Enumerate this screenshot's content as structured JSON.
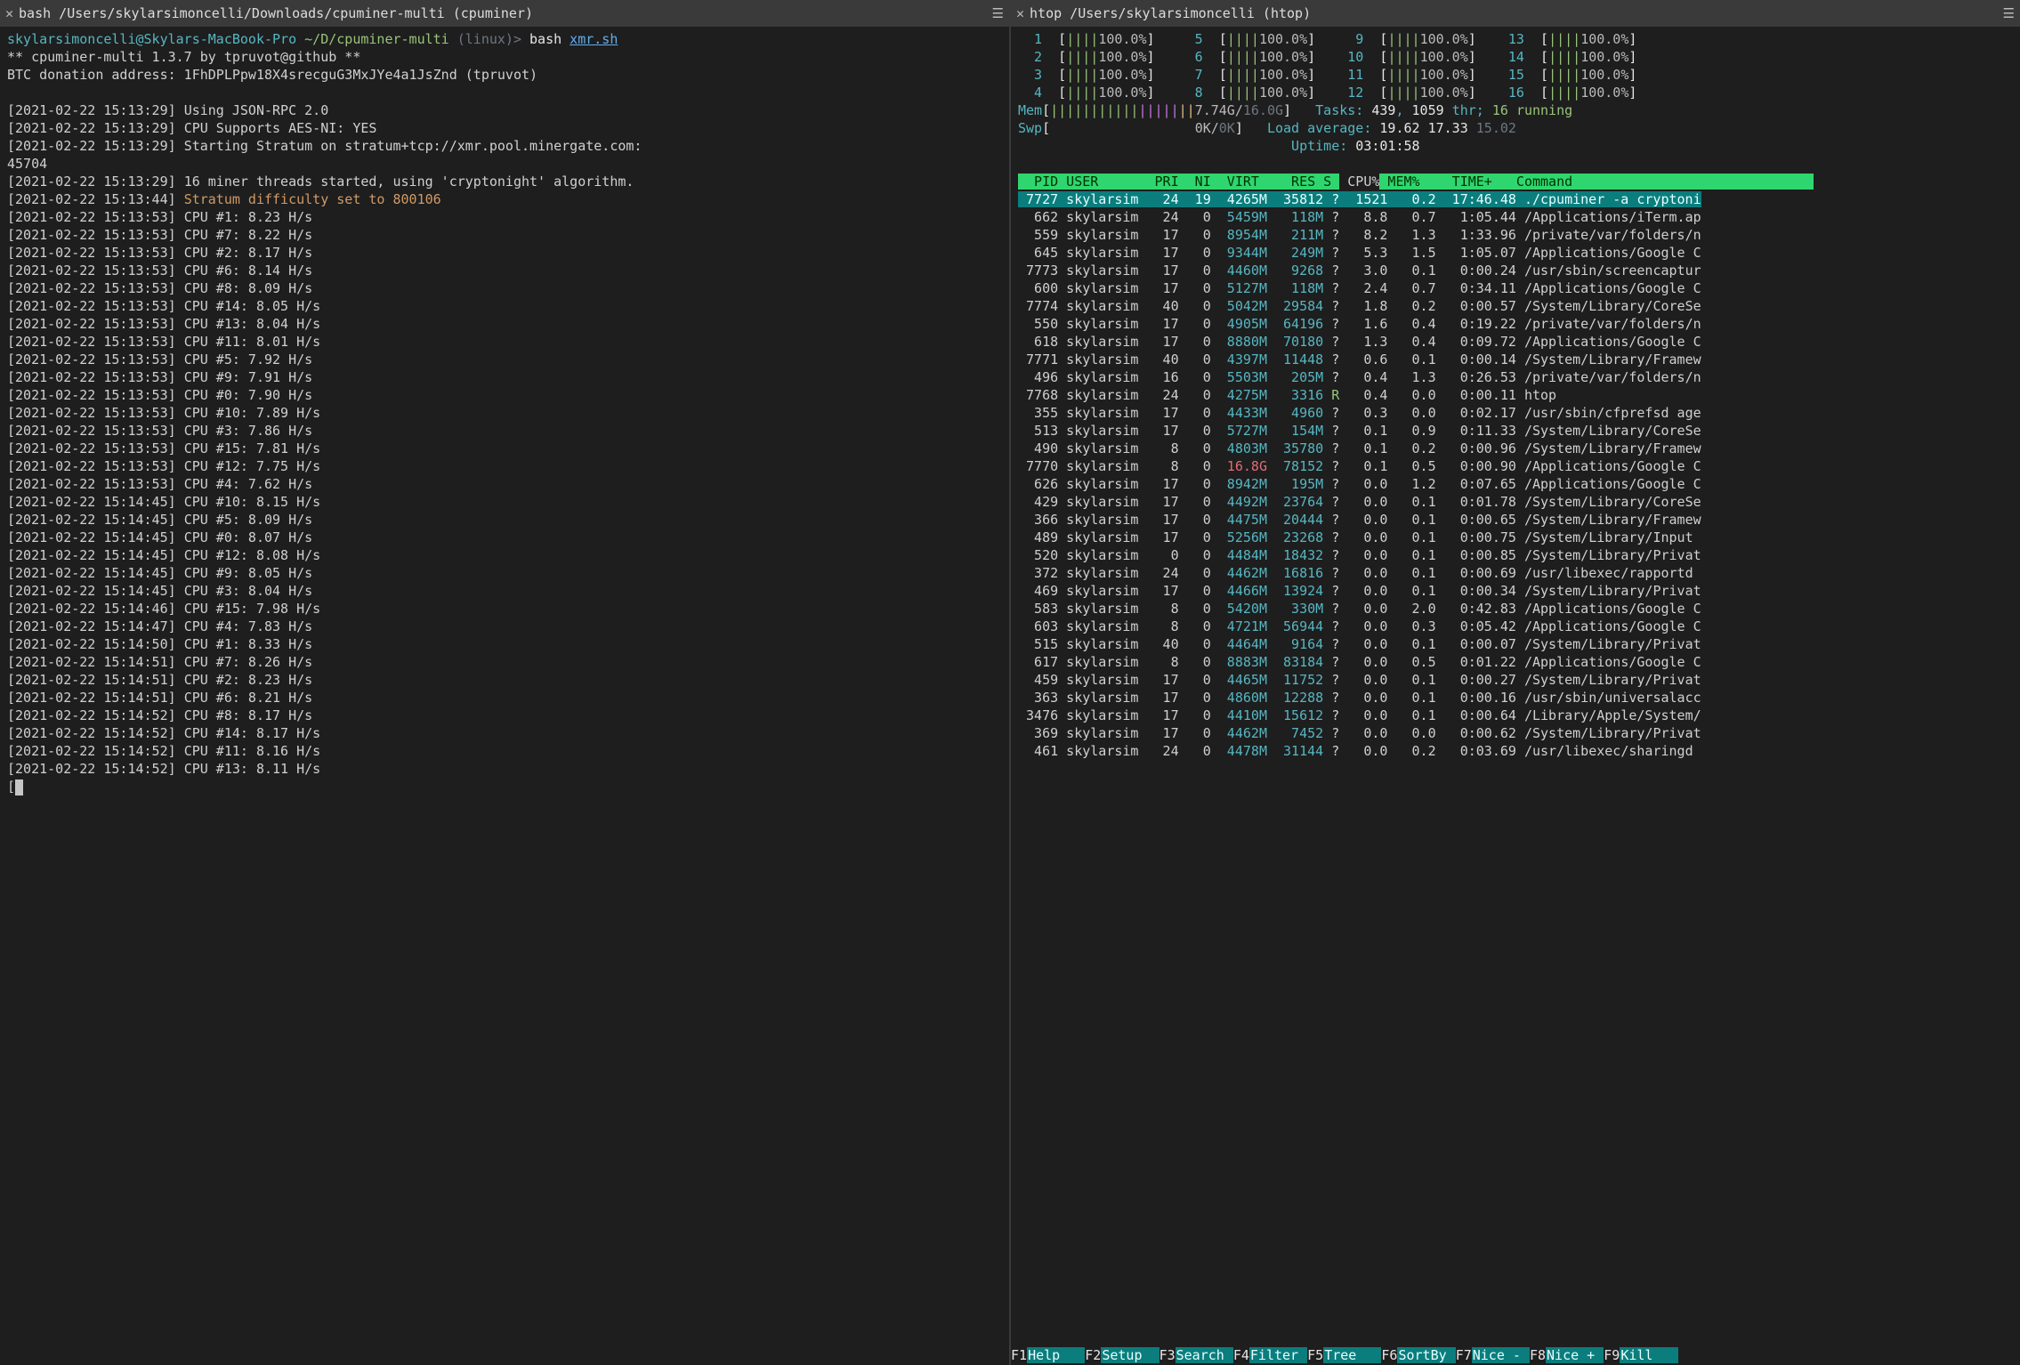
{
  "left": {
    "tab_title": "bash /Users/skylarsimoncelli/Downloads/cpuminer-multi (cpuminer)",
    "prompt": {
      "userhost": "skylarsimoncelli@Skylars-MacBook-Pro",
      "path": "~/D/cpuminer-multi",
      "env": "(linux)",
      "sep": ">",
      "cmd": "bash",
      "arg": "xmr.sh"
    },
    "plain": [
      "** cpuminer-multi 1.3.7 by tpruvot@github **",
      "BTC donation address: 1FhDPLPpw18X4srecguG3MxJYe4a1JsZnd (tpruvot)",
      ""
    ],
    "loglines": [
      {
        "ts": "[2021-02-22 15:13:29]",
        "msg": "Using JSON-RPC 2.0"
      },
      {
        "ts": "[2021-02-22 15:13:29]",
        "msg": "CPU Supports AES-NI: YES"
      },
      {
        "ts": "[2021-02-22 15:13:29]",
        "msg": "Starting Stratum on stratum+tcp://xmr.pool.minergate.com:"
      },
      {
        "cont": "45704"
      },
      {
        "ts": "[2021-02-22 15:13:29]",
        "msg": "16 miner threads started, using 'cryptonight' algorithm."
      },
      {
        "ts": "[2021-02-22 15:13:44]",
        "msg": "Stratum difficulty set to 800106",
        "yellow": true
      },
      {
        "ts": "[2021-02-22 15:13:53]",
        "msg": "CPU #1: 8.23 H/s"
      },
      {
        "ts": "[2021-02-22 15:13:53]",
        "msg": "CPU #7: 8.22 H/s"
      },
      {
        "ts": "[2021-02-22 15:13:53]",
        "msg": "CPU #2: 8.17 H/s"
      },
      {
        "ts": "[2021-02-22 15:13:53]",
        "msg": "CPU #6: 8.14 H/s"
      },
      {
        "ts": "[2021-02-22 15:13:53]",
        "msg": "CPU #8: 8.09 H/s"
      },
      {
        "ts": "[2021-02-22 15:13:53]",
        "msg": "CPU #14: 8.05 H/s"
      },
      {
        "ts": "[2021-02-22 15:13:53]",
        "msg": "CPU #13: 8.04 H/s"
      },
      {
        "ts": "[2021-02-22 15:13:53]",
        "msg": "CPU #11: 8.01 H/s"
      },
      {
        "ts": "[2021-02-22 15:13:53]",
        "msg": "CPU #5: 7.92 H/s"
      },
      {
        "ts": "[2021-02-22 15:13:53]",
        "msg": "CPU #9: 7.91 H/s"
      },
      {
        "ts": "[2021-02-22 15:13:53]",
        "msg": "CPU #0: 7.90 H/s"
      },
      {
        "ts": "[2021-02-22 15:13:53]",
        "msg": "CPU #10: 7.89 H/s"
      },
      {
        "ts": "[2021-02-22 15:13:53]",
        "msg": "CPU #3: 7.86 H/s"
      },
      {
        "ts": "[2021-02-22 15:13:53]",
        "msg": "CPU #15: 7.81 H/s"
      },
      {
        "ts": "[2021-02-22 15:13:53]",
        "msg": "CPU #12: 7.75 H/s"
      },
      {
        "ts": "[2021-02-22 15:13:53]",
        "msg": "CPU #4: 7.62 H/s"
      },
      {
        "ts": "[2021-02-22 15:14:45]",
        "msg": "CPU #10: 8.15 H/s"
      },
      {
        "ts": "[2021-02-22 15:14:45]",
        "msg": "CPU #5: 8.09 H/s"
      },
      {
        "ts": "[2021-02-22 15:14:45]",
        "msg": "CPU #0: 8.07 H/s"
      },
      {
        "ts": "[2021-02-22 15:14:45]",
        "msg": "CPU #12: 8.08 H/s"
      },
      {
        "ts": "[2021-02-22 15:14:45]",
        "msg": "CPU #9: 8.05 H/s"
      },
      {
        "ts": "[2021-02-22 15:14:45]",
        "msg": "CPU #3: 8.04 H/s"
      },
      {
        "ts": "[2021-02-22 15:14:46]",
        "msg": "CPU #15: 7.98 H/s"
      },
      {
        "ts": "[2021-02-22 15:14:47]",
        "msg": "CPU #4: 7.83 H/s"
      },
      {
        "ts": "[2021-02-22 15:14:50]",
        "msg": "CPU #1: 8.33 H/s"
      },
      {
        "ts": "[2021-02-22 15:14:51]",
        "msg": "CPU #7: 8.26 H/s"
      },
      {
        "ts": "[2021-02-22 15:14:51]",
        "msg": "CPU #2: 8.23 H/s"
      },
      {
        "ts": "[2021-02-22 15:14:51]",
        "msg": "CPU #6: 8.21 H/s"
      },
      {
        "ts": "[2021-02-22 15:14:52]",
        "msg": "CPU #8: 8.17 H/s"
      },
      {
        "ts": "[2021-02-22 15:14:52]",
        "msg": "CPU #14: 8.17 H/s"
      },
      {
        "ts": "[2021-02-22 15:14:52]",
        "msg": "CPU #11: 8.16 H/s"
      },
      {
        "ts": "[2021-02-22 15:14:52]",
        "msg": "CPU #13: 8.11 H/s"
      }
    ]
  },
  "right": {
    "tab_title": "htop /Users/skylarsimoncelli (htop)",
    "cpus": [
      {
        "n": "1",
        "pct": "100.0%"
      },
      {
        "n": "5",
        "pct": "100.0%"
      },
      {
        "n": "9",
        "pct": "100.0%"
      },
      {
        "n": "13",
        "pct": "100.0%"
      },
      {
        "n": "2",
        "pct": "100.0%"
      },
      {
        "n": "6",
        "pct": "100.0%"
      },
      {
        "n": "10",
        "pct": "100.0%"
      },
      {
        "n": "14",
        "pct": "100.0%"
      },
      {
        "n": "3",
        "pct": "100.0%"
      },
      {
        "n": "7",
        "pct": "100.0%"
      },
      {
        "n": "11",
        "pct": "100.0%"
      },
      {
        "n": "15",
        "pct": "100.0%"
      },
      {
        "n": "4",
        "pct": "100.0%"
      },
      {
        "n": "8",
        "pct": "100.0%"
      },
      {
        "n": "12",
        "pct": "100.0%"
      },
      {
        "n": "16",
        "pct": "100.0%"
      }
    ],
    "mem": {
      "label": "Mem",
      "used": "7.74G",
      "total": "16.0G"
    },
    "swp": {
      "label": "Swp",
      "used": "0K",
      "total": "0K"
    },
    "tasks": {
      "label": "Tasks:",
      "procs": "439",
      "thr_label": "1059",
      "thr_word": "thr;",
      "running": "16",
      "run_word": "running"
    },
    "load": {
      "label": "Load average:",
      "v1": "19.62",
      "v2": "17.33",
      "v3": "15.02"
    },
    "uptime": {
      "label": "Uptime:",
      "val": "03:01:58"
    },
    "header": [
      "  PID",
      "USER     ",
      " PRI",
      " NI",
      " VIRT",
      "  RES",
      "S",
      " CPU%",
      "MEM%",
      "   TIME+ ",
      " Command"
    ],
    "procs": [
      {
        "sel": true,
        "pid": "7727",
        "user": "skylarsim",
        "pri": "24",
        "ni": "19",
        "virt": "4265M",
        "res": "35812",
        "s": "?",
        "cpu": "1521",
        "mem": "0.2",
        "time": "17:46.48",
        "cmd": "./cpuminer -a cryptoni"
      },
      {
        "pid": "662",
        "user": "skylarsim",
        "pri": "24",
        "ni": "0",
        "virt": "5459M",
        "res": "118M",
        "s": "?",
        "cpu": "8.8",
        "mem": "0.7",
        "time": "1:05.44",
        "cmd": "/Applications/iTerm.ap"
      },
      {
        "pid": "559",
        "user": "skylarsim",
        "pri": "17",
        "ni": "0",
        "virt": "8954M",
        "res": "211M",
        "s": "?",
        "cpu": "8.2",
        "mem": "1.3",
        "time": "1:33.96",
        "cmd": "/private/var/folders/n"
      },
      {
        "pid": "645",
        "user": "skylarsim",
        "pri": "17",
        "ni": "0",
        "virt": "9344M",
        "res": "249M",
        "s": "?",
        "cpu": "5.3",
        "mem": "1.5",
        "time": "1:05.07",
        "cmd": "/Applications/Google C"
      },
      {
        "pid": "7773",
        "user": "skylarsim",
        "pri": "17",
        "ni": "0",
        "virt": "4460M",
        "res": "9268",
        "s": "?",
        "cpu": "3.0",
        "mem": "0.1",
        "time": "0:00.24",
        "cmd": "/usr/sbin/screencaptur"
      },
      {
        "pid": "600",
        "user": "skylarsim",
        "pri": "17",
        "ni": "0",
        "virt": "5127M",
        "res": "118M",
        "s": "?",
        "cpu": "2.4",
        "mem": "0.7",
        "time": "0:34.11",
        "cmd": "/Applications/Google C"
      },
      {
        "pid": "7774",
        "user": "skylarsim",
        "pri": "40",
        "ni": "0",
        "virt": "5042M",
        "res": "29584",
        "s": "?",
        "cpu": "1.8",
        "mem": "0.2",
        "time": "0:00.57",
        "cmd": "/System/Library/CoreSe"
      },
      {
        "pid": "550",
        "user": "skylarsim",
        "pri": "17",
        "ni": "0",
        "virt": "4905M",
        "res": "64196",
        "s": "?",
        "cpu": "1.6",
        "mem": "0.4",
        "time": "0:19.22",
        "cmd": "/private/var/folders/n"
      },
      {
        "pid": "618",
        "user": "skylarsim",
        "pri": "17",
        "ni": "0",
        "virt": "8880M",
        "res": "70180",
        "s": "?",
        "cpu": "1.3",
        "mem": "0.4",
        "time": "0:09.72",
        "cmd": "/Applications/Google C"
      },
      {
        "pid": "7771",
        "user": "skylarsim",
        "pri": "40",
        "ni": "0",
        "virt": "4397M",
        "res": "11448",
        "s": "?",
        "cpu": "0.6",
        "mem": "0.1",
        "time": "0:00.14",
        "cmd": "/System/Library/Framew"
      },
      {
        "pid": "496",
        "user": "skylarsim",
        "pri": "16",
        "ni": "0",
        "virt": "5503M",
        "res": "205M",
        "s": "?",
        "cpu": "0.4",
        "mem": "1.3",
        "time": "0:26.53",
        "cmd": "/private/var/folders/n"
      },
      {
        "pid": "7768",
        "user": "skylarsim",
        "pri": "24",
        "ni": "0",
        "virt": "4275M",
        "res": "3316",
        "s": "R",
        "cpu": "0.4",
        "mem": "0.0",
        "time": "0:00.11",
        "cmd": "htop",
        "green": true
      },
      {
        "pid": "355",
        "user": "skylarsim",
        "pri": "17",
        "ni": "0",
        "virt": "4433M",
        "res": "4960",
        "s": "?",
        "cpu": "0.3",
        "mem": "0.0",
        "time": "0:02.17",
        "cmd": "/usr/sbin/cfprefsd age"
      },
      {
        "pid": "513",
        "user": "skylarsim",
        "pri": "17",
        "ni": "0",
        "virt": "5727M",
        "res": "154M",
        "s": "?",
        "cpu": "0.1",
        "mem": "0.9",
        "time": "0:11.33",
        "cmd": "/System/Library/CoreSe"
      },
      {
        "pid": "490",
        "user": "skylarsim",
        "pri": "8",
        "ni": "0",
        "virt": "4803M",
        "res": "35780",
        "s": "?",
        "cpu": "0.1",
        "mem": "0.2",
        "time": "0:00.96",
        "cmd": "/System/Library/Framew"
      },
      {
        "pid": "7770",
        "user": "skylarsim",
        "pri": "8",
        "ni": "0",
        "virt": "16.8G",
        "virt_red": true,
        "res": "78152",
        "s": "?",
        "cpu": "0.1",
        "mem": "0.5",
        "time": "0:00.90",
        "cmd": "/Applications/Google C"
      },
      {
        "pid": "626",
        "user": "skylarsim",
        "pri": "17",
        "ni": "0",
        "virt": "8942M",
        "res": "195M",
        "s": "?",
        "cpu": "0.0",
        "mem": "1.2",
        "time": "0:07.65",
        "cmd": "/Applications/Google C"
      },
      {
        "pid": "429",
        "user": "skylarsim",
        "pri": "17",
        "ni": "0",
        "virt": "4492M",
        "res": "23764",
        "s": "?",
        "cpu": "0.0",
        "mem": "0.1",
        "time": "0:01.78",
        "cmd": "/System/Library/CoreSe"
      },
      {
        "pid": "366",
        "user": "skylarsim",
        "pri": "17",
        "ni": "0",
        "virt": "4475M",
        "res": "20444",
        "s": "?",
        "cpu": "0.0",
        "mem": "0.1",
        "time": "0:00.65",
        "cmd": "/System/Library/Framew"
      },
      {
        "pid": "489",
        "user": "skylarsim",
        "pri": "17",
        "ni": "0",
        "virt": "5256M",
        "res": "23268",
        "s": "?",
        "cpu": "0.0",
        "mem": "0.1",
        "time": "0:00.75",
        "cmd": "/System/Library/Input"
      },
      {
        "pid": "520",
        "user": "skylarsim",
        "pri": "0",
        "ni": "0",
        "virt": "4484M",
        "res": "18432",
        "s": "?",
        "cpu": "0.0",
        "mem": "0.1",
        "time": "0:00.85",
        "cmd": "/System/Library/Privat"
      },
      {
        "pid": "372",
        "user": "skylarsim",
        "pri": "24",
        "ni": "0",
        "virt": "4462M",
        "res": "16816",
        "s": "?",
        "cpu": "0.0",
        "mem": "0.1",
        "time": "0:00.69",
        "cmd": "/usr/libexec/rapportd"
      },
      {
        "pid": "469",
        "user": "skylarsim",
        "pri": "17",
        "ni": "0",
        "virt": "4466M",
        "res": "13924",
        "s": "?",
        "cpu": "0.0",
        "mem": "0.1",
        "time": "0:00.34",
        "cmd": "/System/Library/Privat"
      },
      {
        "pid": "583",
        "user": "skylarsim",
        "pri": "8",
        "ni": "0",
        "virt": "5420M",
        "res": "330M",
        "s": "?",
        "cpu": "0.0",
        "mem": "2.0",
        "time": "0:42.83",
        "cmd": "/Applications/Google C"
      },
      {
        "pid": "603",
        "user": "skylarsim",
        "pri": "8",
        "ni": "0",
        "virt": "4721M",
        "res": "56944",
        "s": "?",
        "cpu": "0.0",
        "mem": "0.3",
        "time": "0:05.42",
        "cmd": "/Applications/Google C"
      },
      {
        "pid": "515",
        "user": "skylarsim",
        "pri": "40",
        "ni": "0",
        "virt": "4464M",
        "res": "9164",
        "s": "?",
        "cpu": "0.0",
        "mem": "0.1",
        "time": "0:00.07",
        "cmd": "/System/Library/Privat"
      },
      {
        "pid": "617",
        "user": "skylarsim",
        "pri": "8",
        "ni": "0",
        "virt": "8883M",
        "res": "83184",
        "s": "?",
        "cpu": "0.0",
        "mem": "0.5",
        "time": "0:01.22",
        "cmd": "/Applications/Google C"
      },
      {
        "pid": "459",
        "user": "skylarsim",
        "pri": "17",
        "ni": "0",
        "virt": "4465M",
        "res": "11752",
        "s": "?",
        "cpu": "0.0",
        "mem": "0.1",
        "time": "0:00.27",
        "cmd": "/System/Library/Privat"
      },
      {
        "pid": "363",
        "user": "skylarsim",
        "pri": "17",
        "ni": "0",
        "virt": "4860M",
        "res": "12288",
        "s": "?",
        "cpu": "0.0",
        "mem": "0.1",
        "time": "0:00.16",
        "cmd": "/usr/sbin/universalacc"
      },
      {
        "pid": "3476",
        "user": "skylarsim",
        "pri": "17",
        "ni": "0",
        "virt": "4410M",
        "res": "15612",
        "s": "?",
        "cpu": "0.0",
        "mem": "0.1",
        "time": "0:00.64",
        "cmd": "/Library/Apple/System/"
      },
      {
        "pid": "369",
        "user": "skylarsim",
        "pri": "17",
        "ni": "0",
        "virt": "4462M",
        "res": "7452",
        "s": "?",
        "cpu": "0.0",
        "mem": "0.0",
        "time": "0:00.62",
        "cmd": "/System/Library/Privat"
      },
      {
        "pid": "461",
        "user": "skylarsim",
        "pri": "24",
        "ni": "0",
        "virt": "4478M",
        "res": "31144",
        "s": "?",
        "cpu": "0.0",
        "mem": "0.2",
        "time": "0:03.69",
        "cmd": "/usr/libexec/sharingd"
      }
    ],
    "fkeys": [
      {
        "k": "F1",
        "n": "Help"
      },
      {
        "k": "F2",
        "n": "Setup"
      },
      {
        "k": "F3",
        "n": "Search"
      },
      {
        "k": "F4",
        "n": "Filter"
      },
      {
        "k": "F5",
        "n": "Tree"
      },
      {
        "k": "F6",
        "n": "SortBy"
      },
      {
        "k": "F7",
        "n": "Nice -"
      },
      {
        "k": "F8",
        "n": "Nice +"
      },
      {
        "k": "F9",
        "n": "Kill"
      }
    ]
  }
}
